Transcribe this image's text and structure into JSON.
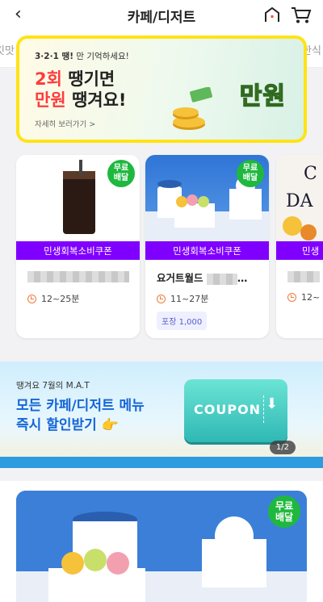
{
  "header": {
    "title": "카페/디저트",
    "back_icon": "‹"
  },
  "tabs": [
    "킷맛",
    "한식"
  ],
  "banner": {
    "small_prefix": "3·2·1 땡!",
    "small_suffix": " 만 기억하세요!",
    "line1_red": "2회",
    "line1_rest": " 땡기면",
    "line2_red": "만원",
    "line2_rest": " 땡겨요!",
    "more": "자세히 보러가기 >",
    "badge": "만원"
  },
  "cards": [
    {
      "coupon": "민생회복소비쿠폰",
      "free": [
        "무료",
        "배달"
      ],
      "name_suffix": "",
      "time": "12~25분",
      "pack": ""
    },
    {
      "coupon": "민생회복소비쿠폰",
      "free": [
        "무료",
        "배달"
      ],
      "name_prefix": "요거트월드",
      "name_suffix": "…",
      "time": "11~27분",
      "pack": "포장 1,000"
    },
    {
      "coupon": "민생",
      "time": "12~"
    }
  ],
  "promo": {
    "line1": "땡겨요 7월의 M.A.T",
    "line2": "모든 카페/디저트 메뉴",
    "line3": "즉시 할인받기",
    "ticket": "COUPON",
    "pager": "1/2"
  },
  "big_card": {
    "free": [
      "무료",
      "배달"
    ]
  },
  "colors": {
    "coupon_purple": "#8000ff",
    "free_green": "#1fb83e",
    "banner_border": "#ffe315",
    "promo_blue": "#1565d6"
  }
}
